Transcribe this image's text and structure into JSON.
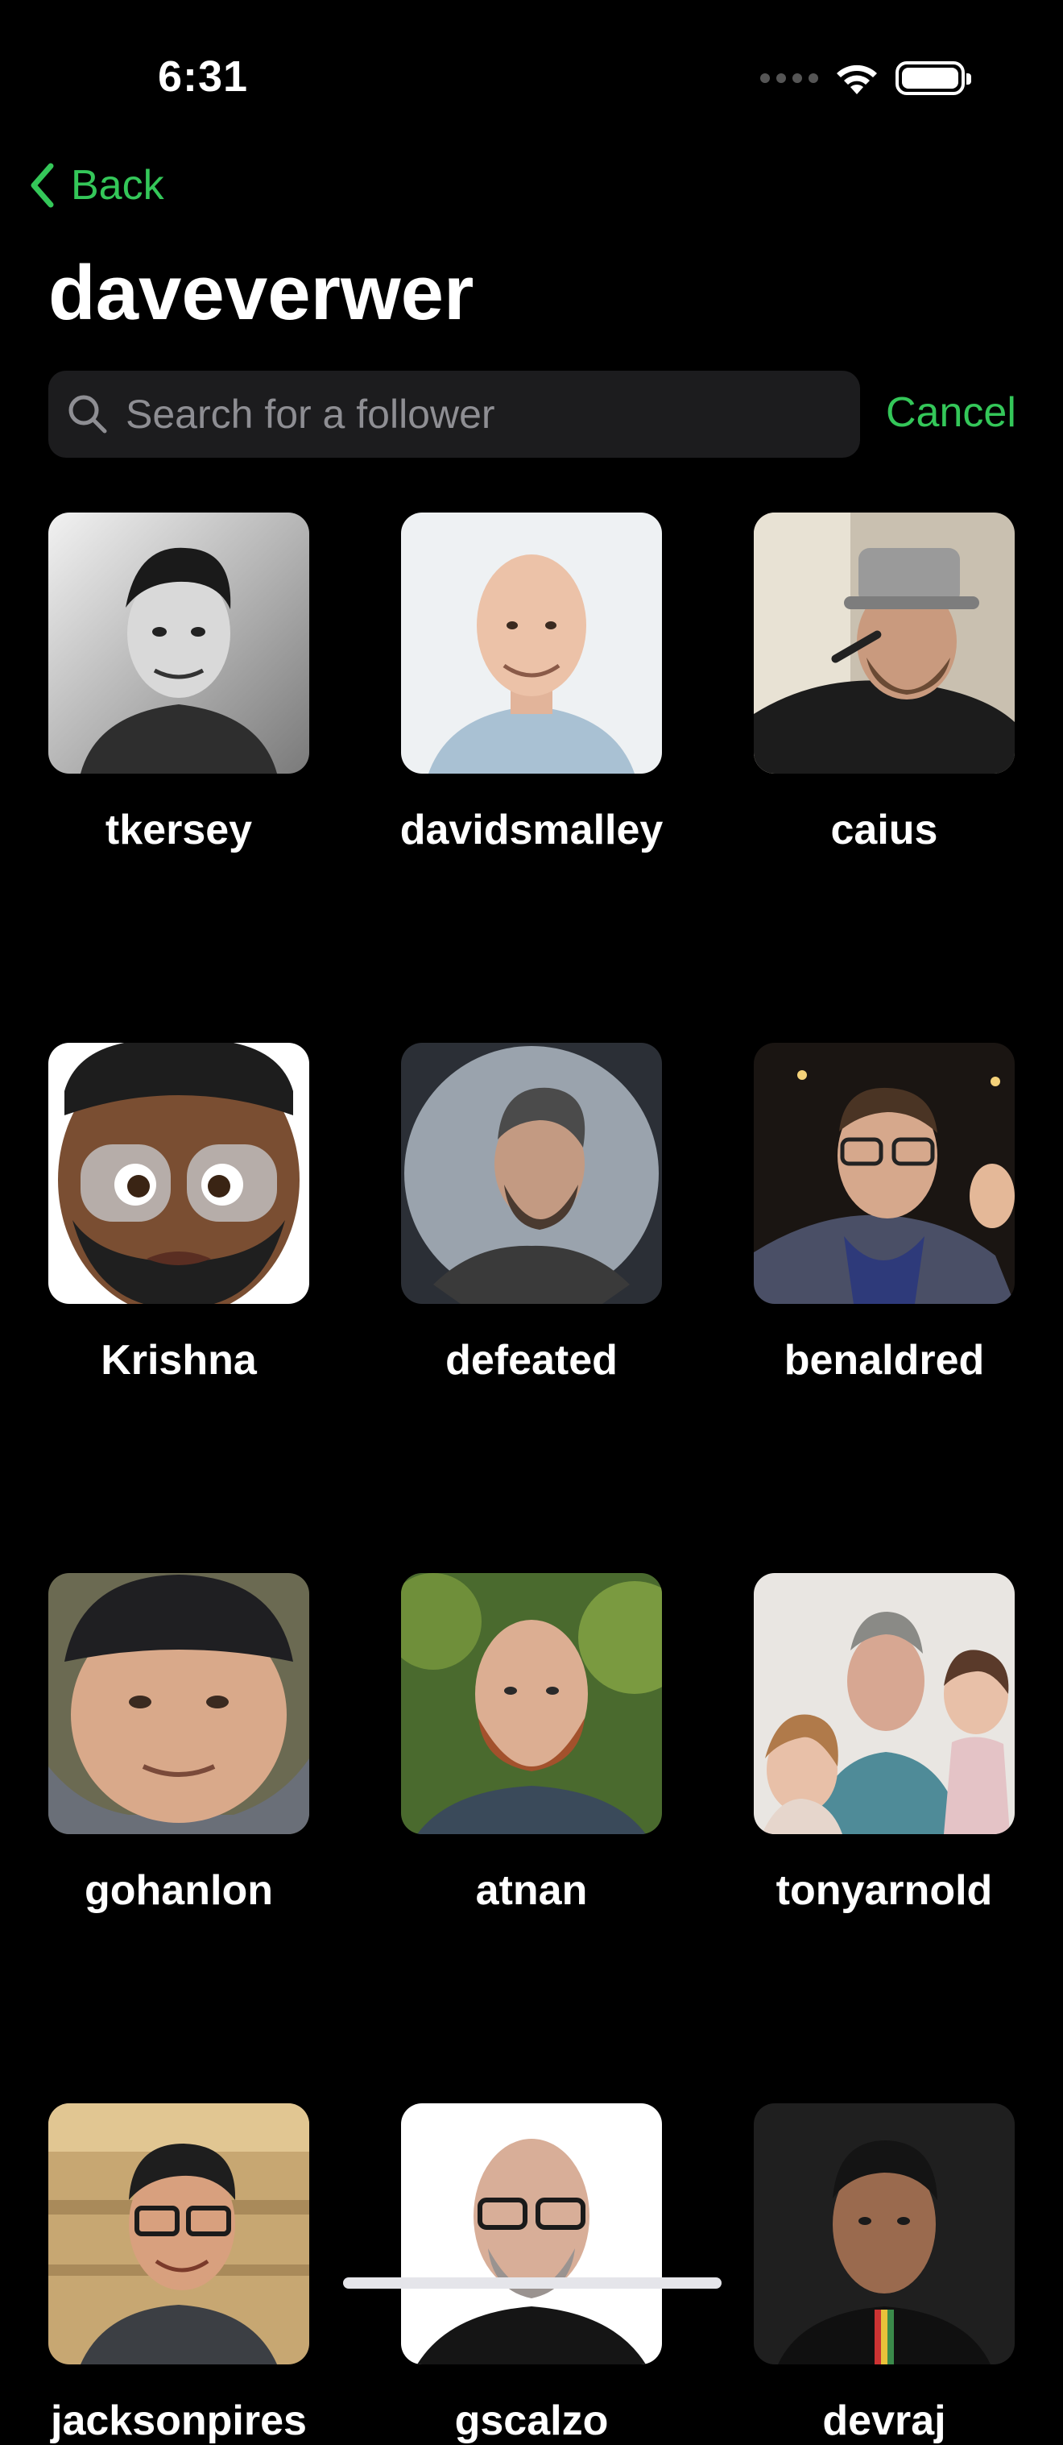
{
  "status_bar": {
    "time": "6:31"
  },
  "nav": {
    "back_label": "Back",
    "title": "daveverwer"
  },
  "search": {
    "placeholder": "Search for a follower",
    "value": "",
    "cancel_label": "Cancel"
  },
  "colors": {
    "accent": "#34c759",
    "background": "#000000",
    "search_field": "#1c1c1e",
    "placeholder": "#8e8e93"
  },
  "followers": [
    {
      "username": "tkersey"
    },
    {
      "username": "davidsmalley"
    },
    {
      "username": "caius"
    },
    {
      "username": "Krishna"
    },
    {
      "username": "defeated"
    },
    {
      "username": "benaldred"
    },
    {
      "username": "gohanlon"
    },
    {
      "username": "atnan"
    },
    {
      "username": "tonyarnold"
    },
    {
      "username": "jacksonpires"
    },
    {
      "username": "gscalzo"
    },
    {
      "username": "devraj"
    }
  ]
}
